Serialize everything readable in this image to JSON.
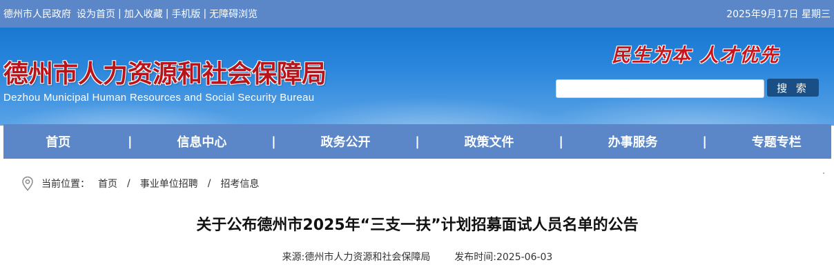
{
  "topbar": {
    "links": [
      "德州市人民政府",
      "设为首页",
      "加入收藏",
      "手机版",
      "无障碍浏览"
    ],
    "date": "2025年9月17日 星期三"
  },
  "header": {
    "title": "德州市人力资源和社会保障局",
    "subtitle": "Dezhou Municipal Human Resources and Social Security Bureau",
    "slogan": "民生为本 人才优先",
    "search": {
      "placeholder": "",
      "button_label": "搜 索"
    }
  },
  "nav": {
    "items": [
      "首页",
      "信息中心",
      "政务公开",
      "政策文件",
      "办事服务",
      "专题专栏"
    ],
    "separator": "|"
  },
  "breadcrumb": {
    "label": "当前位置：",
    "items": [
      "首页",
      "事业单位招聘",
      "招考信息"
    ],
    "separator": "/"
  },
  "article": {
    "title": "关于公布德州市2025年“三支一扶”计划招募面试人员名单的公告",
    "source": "来源:德州市人力资源和社会保障局",
    "published": "发布时间:2025-06-03"
  },
  "colors": {
    "topbar_bg": "#5b86c7",
    "banner_top": "#1a78d2",
    "title_red": "#b8141b",
    "search_button_bg": "#1a4f86"
  }
}
